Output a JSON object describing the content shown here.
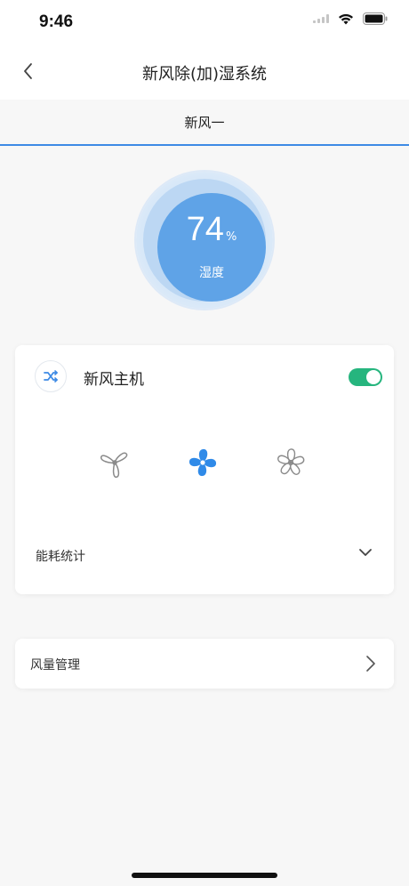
{
  "status_bar": {
    "time": "9:46"
  },
  "nav": {
    "title": "新风除(加)湿系统"
  },
  "tabs": [
    {
      "label": "新风一",
      "active": true
    }
  ],
  "humidity": {
    "value": "74",
    "unit": "%",
    "label": "湿度"
  },
  "device": {
    "title": "新风主机",
    "power_on": true,
    "fan_speeds": [
      {
        "icon": "fan-low-icon",
        "active": false
      },
      {
        "icon": "fan-medium-icon",
        "active": true
      },
      {
        "icon": "fan-high-icon",
        "active": false
      }
    ],
    "energy_label": "能耗统计"
  },
  "airflow": {
    "label": "风量管理"
  },
  "colors": {
    "accent": "#3d8ae5",
    "fan_active": "#2f8ae8",
    "toggle_on": "#26b57e",
    "gauge": "#5fa3e7"
  }
}
